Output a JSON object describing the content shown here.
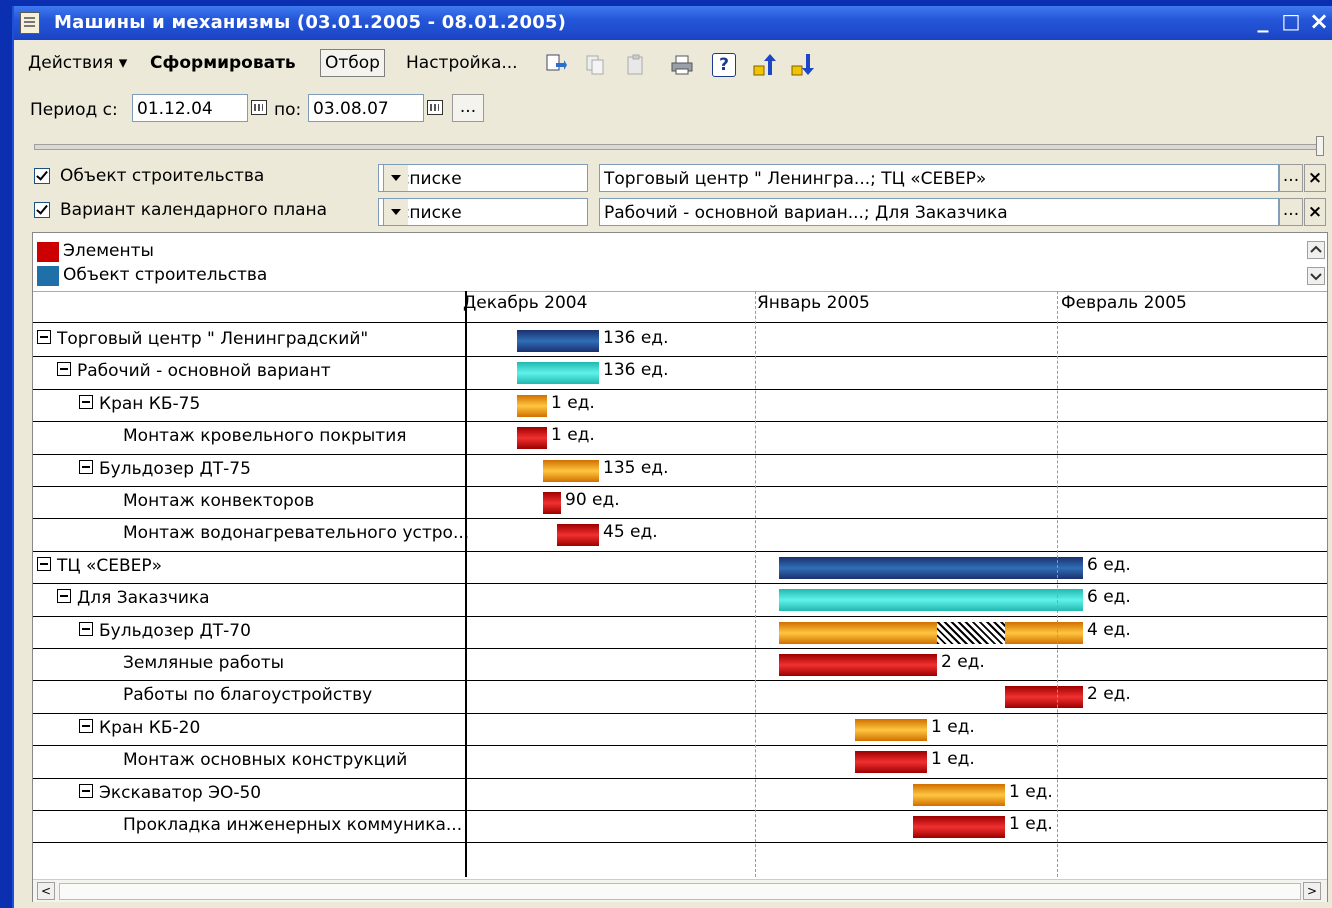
{
  "window": {
    "title": "Машины и механизмы (03.01.2005 - 08.01.2005)",
    "minimize": "_",
    "maximize": "□",
    "close": "×"
  },
  "toolbar": {
    "actions_label": "Действия ▾",
    "generate_label": "Сформировать",
    "filter_label": "Отбор",
    "settings_label": "Настройка...",
    "icons": [
      "import-icon",
      "copy-icon",
      "paste-icon",
      "print-icon",
      "help-icon",
      "move-up-icon",
      "move-down-icon"
    ],
    "help_glyph": "?"
  },
  "period": {
    "from_label": "Период с:",
    "from_value": "01.12.04",
    "to_label": "по:",
    "to_value": "03.08.07",
    "more_label": "..."
  },
  "filters": [
    {
      "checked": true,
      "label": "Объект строительства",
      "condition": "В списке",
      "value": "Торговый центр \" Ленингра...; ТЦ «СЕВЕР»"
    },
    {
      "checked": true,
      "label": "Вариант календарного плана",
      "condition": "В списке",
      "value": "Рабочий - основной вариан...; Для Заказчика"
    }
  ],
  "filter_buttons": {
    "select": "...",
    "clear": "×"
  },
  "legend": [
    {
      "label": "Элементы",
      "color": "#cc0000"
    },
    {
      "label": "Объект строительства",
      "color": "#1f6fa8"
    }
  ],
  "months": [
    "Декабрь 2004",
    "Январь 2005",
    "Февраль 2005"
  ],
  "rows": [
    {
      "label": "Торговый центр \" Ленинградский\"",
      "value": "136 ед."
    },
    {
      "label": "Рабочий - основной вариант",
      "value": "136 ед."
    },
    {
      "label": "Кран КБ-75",
      "value": "1 ед."
    },
    {
      "label": "Монтаж кровельного покрытия",
      "value": "1 ед."
    },
    {
      "label": "Бульдозер ДТ-75",
      "value": "135 ед."
    },
    {
      "label": "Монтаж конвекторов",
      "value": "90 ед."
    },
    {
      "label": "Монтаж водонагревательного устро...",
      "value": "45 ед."
    },
    {
      "label": "ТЦ «СЕВЕР»",
      "value": "6 ед."
    },
    {
      "label": "Для Заказчика",
      "value": "6 ед."
    },
    {
      "label": "Бульдозер ДТ-70",
      "value": "4 ед."
    },
    {
      "label": "Земляные работы",
      "value": "2 ед."
    },
    {
      "label": "Работы по благоустройству",
      "value": "2 ед."
    },
    {
      "label": "Кран КБ-20",
      "value": "1 ед."
    },
    {
      "label": "Монтаж основных конструкций",
      "value": "1 ед."
    },
    {
      "label": "Экскаватор ЭО-50",
      "value": "1 ед."
    },
    {
      "label": "Прокладка инженерных коммуника...",
      "value": "1 ед."
    }
  ],
  "colors": {
    "title_bar": "#2456d8",
    "window_bg": "#ece9d8",
    "navy_bar": "#1f4f8f",
    "cyan_bar": "#3fe0d8",
    "orange_bar": "#f5a020",
    "red_bar": "#d81010"
  },
  "scroll": {
    "left": "<",
    "right": ">",
    "up": "^",
    "down": "v"
  }
}
